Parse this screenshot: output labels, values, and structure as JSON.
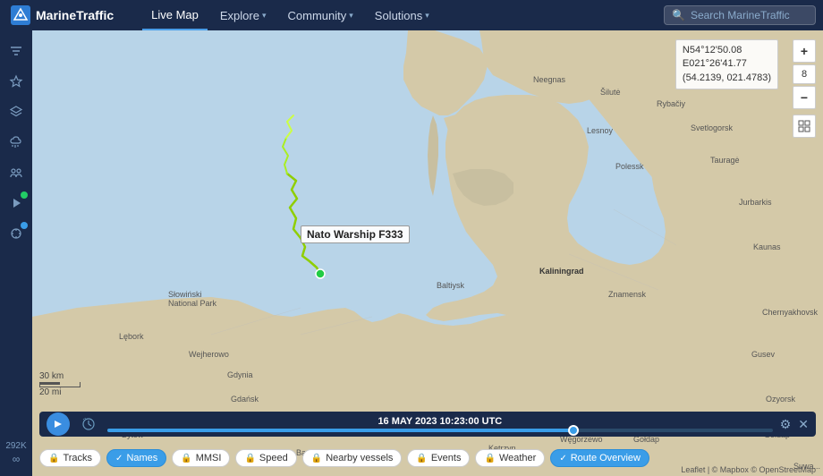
{
  "app": {
    "name": "MarineTraffic",
    "logo_letter": "MT"
  },
  "navbar": {
    "links": [
      {
        "label": "Live Map",
        "active": true,
        "has_chevron": false
      },
      {
        "label": "Explore",
        "active": false,
        "has_chevron": true
      },
      {
        "label": "Community",
        "active": false,
        "has_chevron": true
      },
      {
        "label": "Solutions",
        "active": false,
        "has_chevron": true
      }
    ],
    "search_placeholder": "Search MarineTraffic"
  },
  "sidebar": {
    "items": [
      {
        "name": "filter-icon",
        "symbol": "⚙",
        "badge": false
      },
      {
        "name": "heart-icon",
        "symbol": "♥",
        "badge": false
      },
      {
        "name": "layers-icon",
        "symbol": "◈",
        "badge": false
      },
      {
        "name": "wind-icon",
        "symbol": "≋",
        "badge": false
      },
      {
        "name": "people-icon",
        "symbol": "✦",
        "badge": false
      },
      {
        "name": "play-icon",
        "symbol": "▶",
        "badge_dot": true
      },
      {
        "name": "compass-icon",
        "symbol": "✇",
        "badge": true
      }
    ],
    "counter_label": "292K",
    "counter_icon": "∞"
  },
  "map": {
    "vessel_label": "Nato Warship F333",
    "coord_line1": "N54°12'50.08",
    "coord_line2": "E021°26'41.77",
    "coord_line3": "(54.2139, 021.4783)",
    "zoom_level": "8"
  },
  "zoom_controls": {
    "plus_label": "+",
    "minus_label": "−",
    "level": "8",
    "map_icon": "⊞"
  },
  "timeline": {
    "play_icon": "⟳",
    "date_label": "16 MAY 2023 10:23:00 UTC",
    "settings_icon": "⚙",
    "close_icon": "✕",
    "progress_pct": 70
  },
  "pills": [
    {
      "label": "Tracks",
      "active": false,
      "icon": "🔒"
    },
    {
      "label": "Names",
      "active": true,
      "icon": "✓"
    },
    {
      "label": "MMSI",
      "active": false,
      "icon": "🔒"
    },
    {
      "label": "Speed",
      "active": false,
      "icon": "🔒"
    },
    {
      "label": "Nearby vessels",
      "active": false,
      "icon": "🔒"
    },
    {
      "label": "Events",
      "active": false,
      "icon": "🔒"
    },
    {
      "label": "Weather",
      "active": false,
      "icon": "🔒"
    },
    {
      "label": "Route Overview",
      "active": true,
      "icon": "✓"
    }
  ],
  "scale": {
    "label": "30 km",
    "label2": "20 mi"
  },
  "attribution": "Leaflet | © Mapbox © OpenStreetMap"
}
